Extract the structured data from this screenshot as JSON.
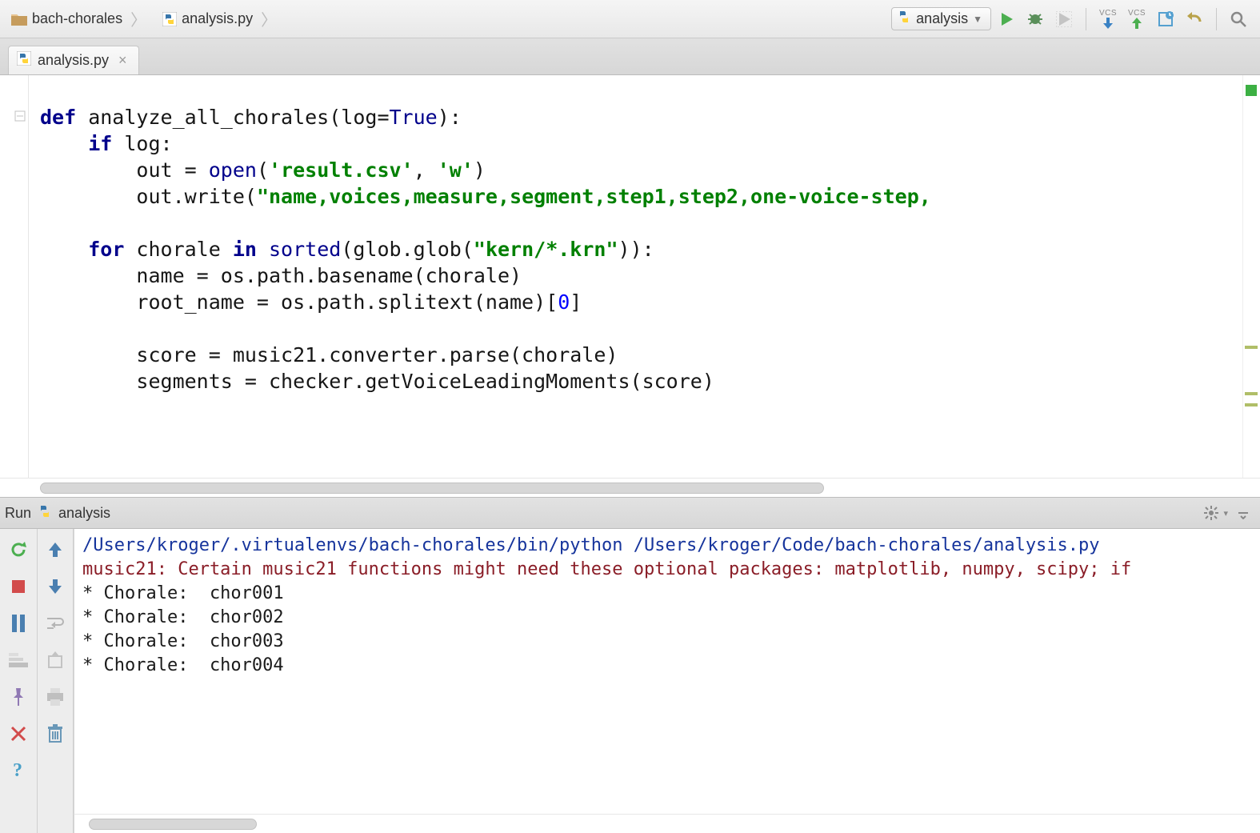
{
  "breadcrumb": {
    "project": "bach-chorales",
    "file": "analysis.py"
  },
  "run_config": {
    "label": "analysis"
  },
  "tab": {
    "label": "analysis.py"
  },
  "run_panel": {
    "title_prefix": "Run",
    "title_name": "analysis"
  },
  "code": {
    "def": "def",
    "fn_name": " analyze_all_chorales(log=",
    "true": "True",
    "fn_close": "):",
    "if": "if",
    "if_rest": " log:",
    "open_lhs": "        out = ",
    "open_fn": "open",
    "open_args_open": "(",
    "open_arg1": "'result.csv'",
    "open_comma": ", ",
    "open_arg2": "'w'",
    "open_args_close": ")",
    "write_lhs": "        out.write(",
    "write_str": "\"name,voices,measure,segment,step1,step2,one-voice-step,",
    "for": "for",
    "for_var": " chorale ",
    "in": "in",
    "sorted": " sorted",
    "for_rest1": "(glob.glob(",
    "glob_str": "\"kern/*.krn\"",
    "for_rest2": ")):",
    "name_line": "        name = os.path.basename(chorale)",
    "root_line1": "        root_name = os.path.splitext(name)[",
    "root_idx": "0",
    "root_line2": "]",
    "score_line": "        score = music21.converter.parse(chorale)",
    "seg_line": "        segments = checker.getVoiceLeadingMoments(score)"
  },
  "console": {
    "cmd": "/Users/kroger/.virtualenvs/bach-chorales/bin/python /Users/kroger/Code/bach-chorales/analysis.py",
    "warn": "music21: Certain music21 functions might need these optional packages: matplotlib, numpy, scipy; if",
    "l1": "* Chorale:  chor001",
    "l2": "* Chorale:  chor002",
    "l3": "* Chorale:  chor003",
    "l4": "* Chorale:  chor004"
  }
}
